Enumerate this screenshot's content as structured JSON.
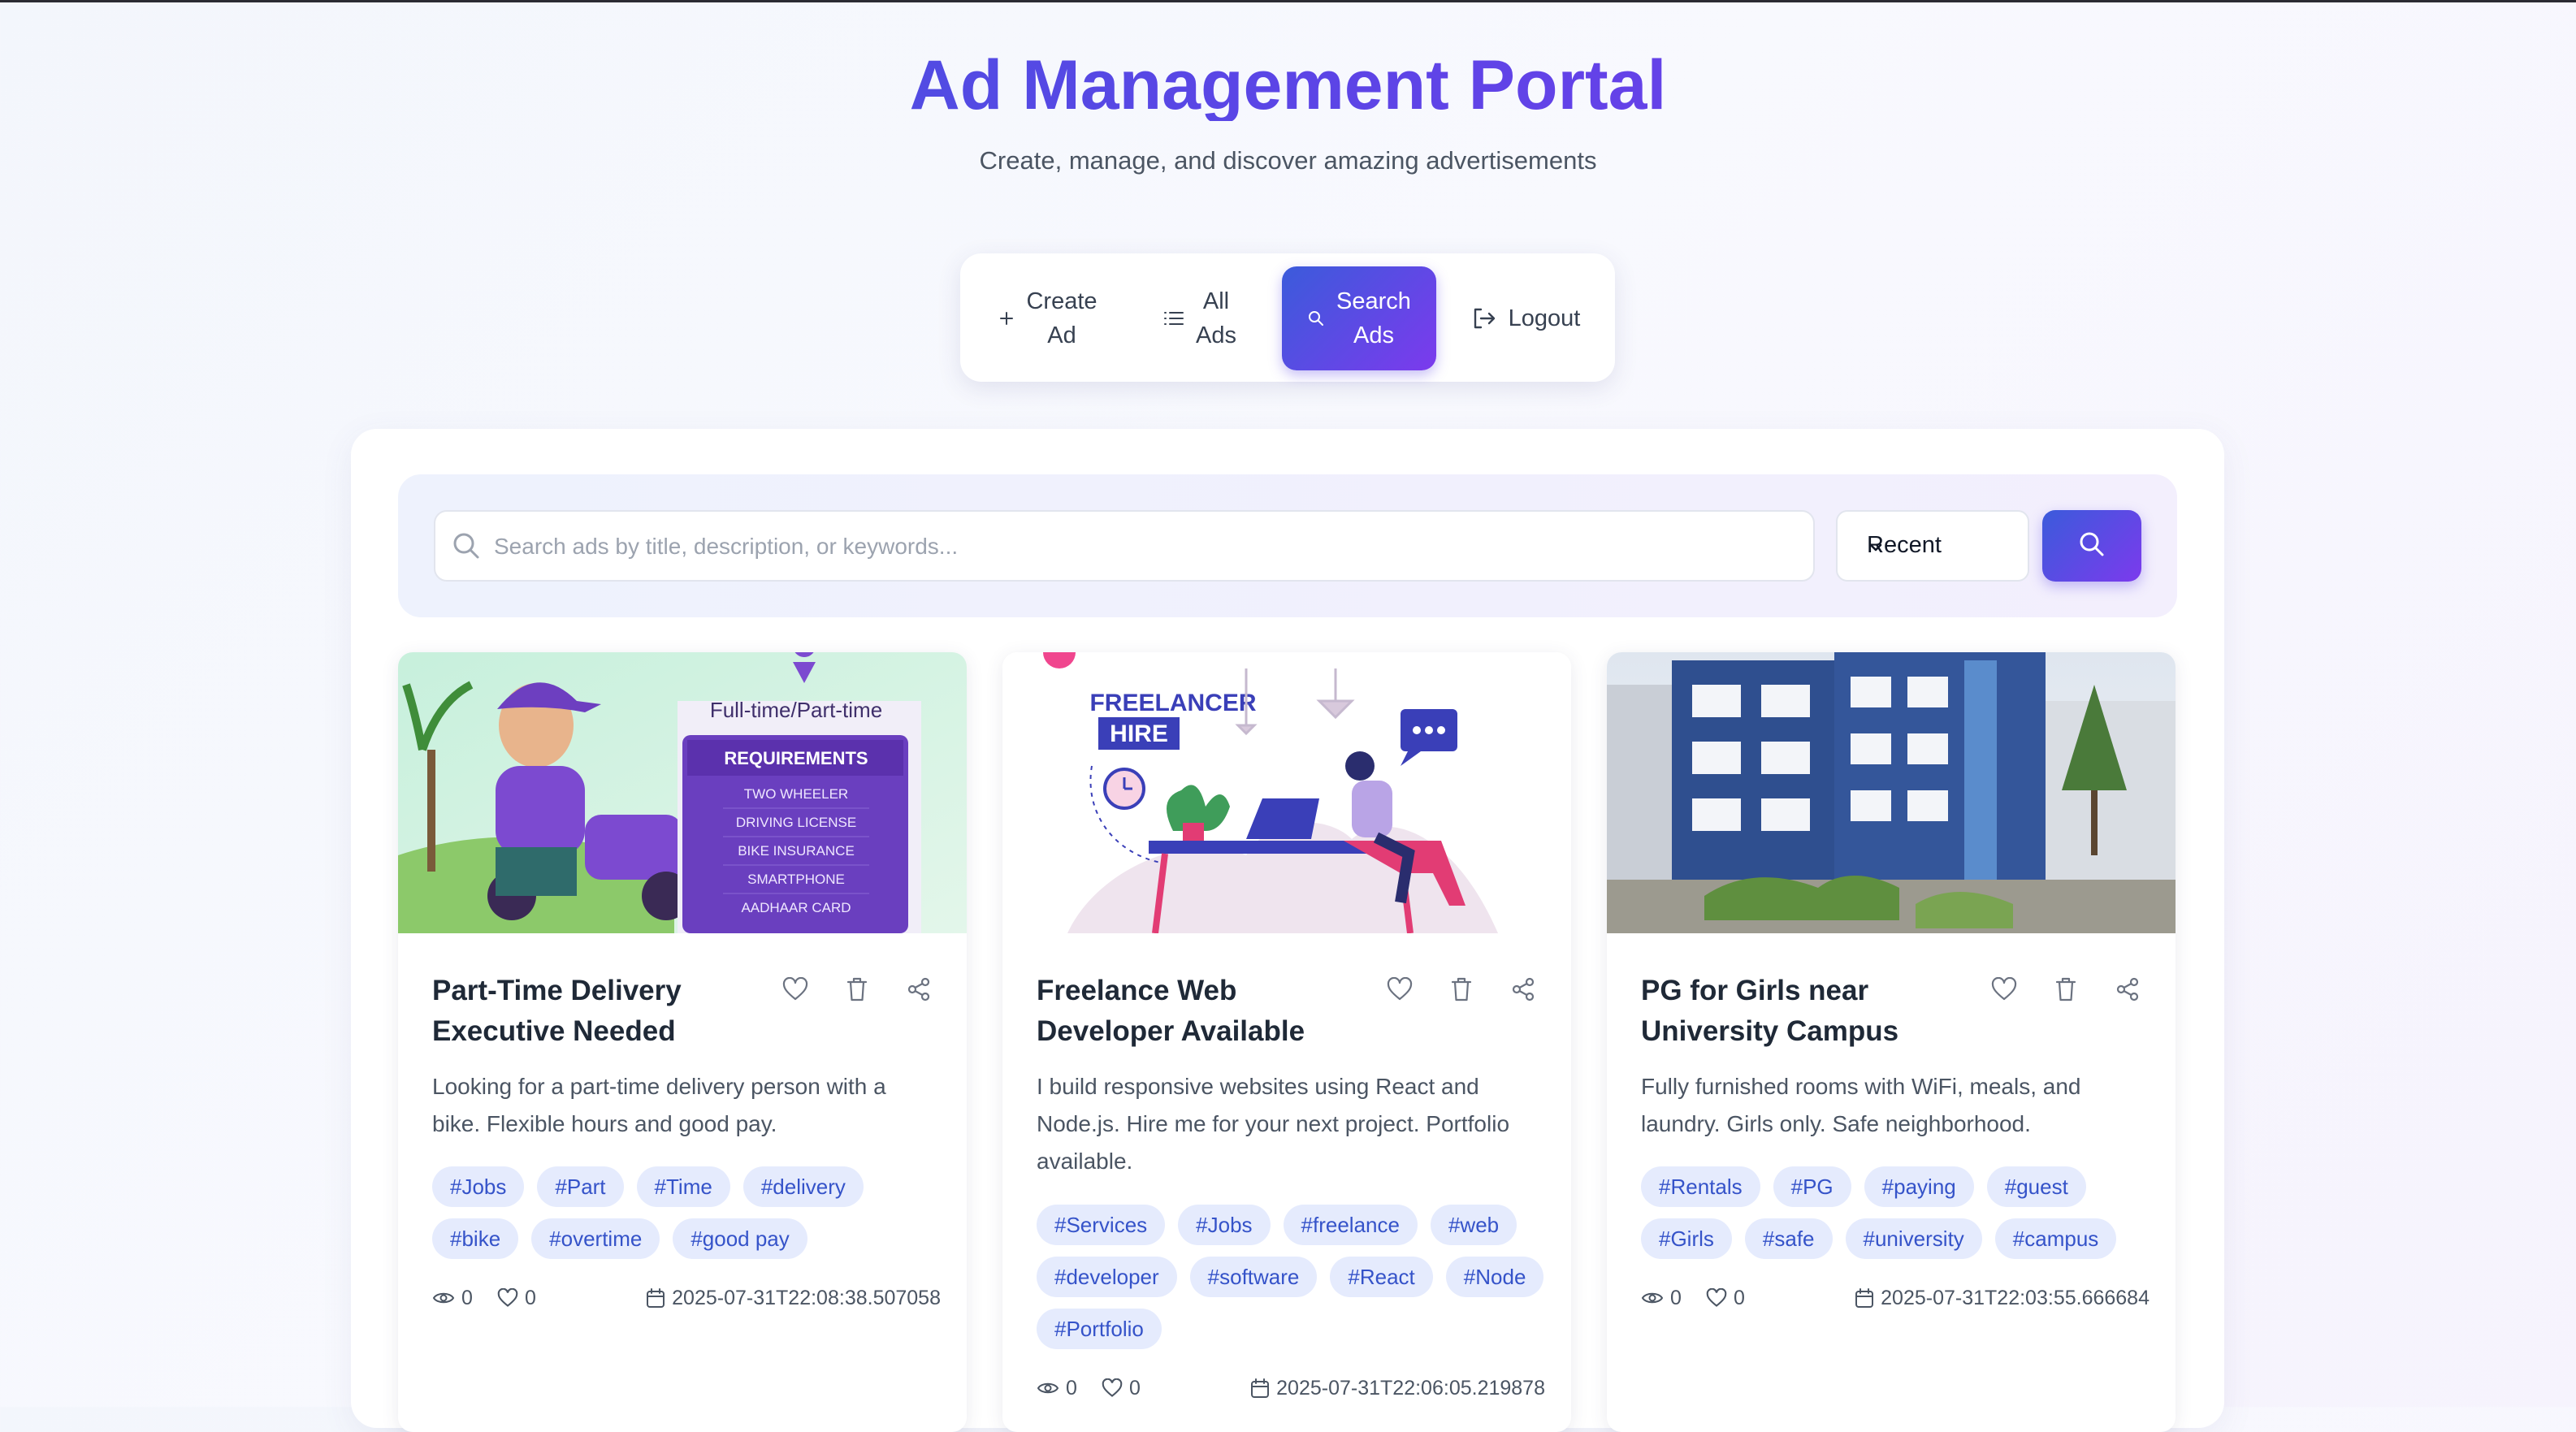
{
  "header": {
    "title": "Ad Management Portal",
    "subtitle": "Create, manage, and discover amazing advertisements"
  },
  "nav": {
    "create_line1": "Create",
    "create_line2": "Ad",
    "all_line1": "All",
    "all_line2": "Ads",
    "search_line1": "Search",
    "search_line2": "Ads",
    "logout": "Logout",
    "active": "Search Ads"
  },
  "search": {
    "placeholder": "Search ads by title, description, or keywords...",
    "value": "",
    "sort_selected": "Recent"
  },
  "colors": {
    "accent_start": "#3b5bdb",
    "accent_end": "#7c3aed",
    "tag_bg": "#e5ebfd",
    "tag_text": "#3553c9"
  },
  "ads": [
    {
      "title": "Part-Time Delivery Executive Needed",
      "description": "Looking for a part-time delivery person with a bike. Flexible hours and good pay.",
      "tags": [
        "#Jobs",
        "#Part",
        "#Time",
        "#delivery",
        "#bike",
        "#overtime",
        "#good pay"
      ],
      "views": "0",
      "likes": "0",
      "date": "2025-07-31T22:08:38.507058",
      "image": {
        "heading": "Full-time/Part-time",
        "box_title": "REQUIREMENTS",
        "items": [
          "TWO WHEELER",
          "DRIVING LICENSE",
          "BIKE INSURANCE",
          "SMARTPHONE",
          "AADHAAR CARD"
        ]
      }
    },
    {
      "title": "Freelance Web Developer Available",
      "description": "I build responsive websites using React and Node.js. Hire me for your next project. Portfolio available.",
      "tags": [
        "#Services",
        "#Jobs",
        "#freelance",
        "#web",
        "#developer",
        "#software",
        "#React",
        "#Node",
        "#Portfolio"
      ],
      "views": "0",
      "likes": "0",
      "date": "2025-07-31T22:06:05.219878",
      "image": {
        "line1": "FREELANCER",
        "line2": "HIRE"
      }
    },
    {
      "title": "PG for Girls near University Campus",
      "description": "Fully furnished rooms with WiFi, meals, and laundry. Girls only. Safe neighborhood.",
      "tags": [
        "#Rentals",
        "#PG",
        "#paying",
        "#guest",
        "#Girls",
        "#safe",
        "#university",
        "#campus"
      ],
      "views": "0",
      "likes": "0",
      "date": "2025-07-31T22:03:55.666684"
    }
  ]
}
